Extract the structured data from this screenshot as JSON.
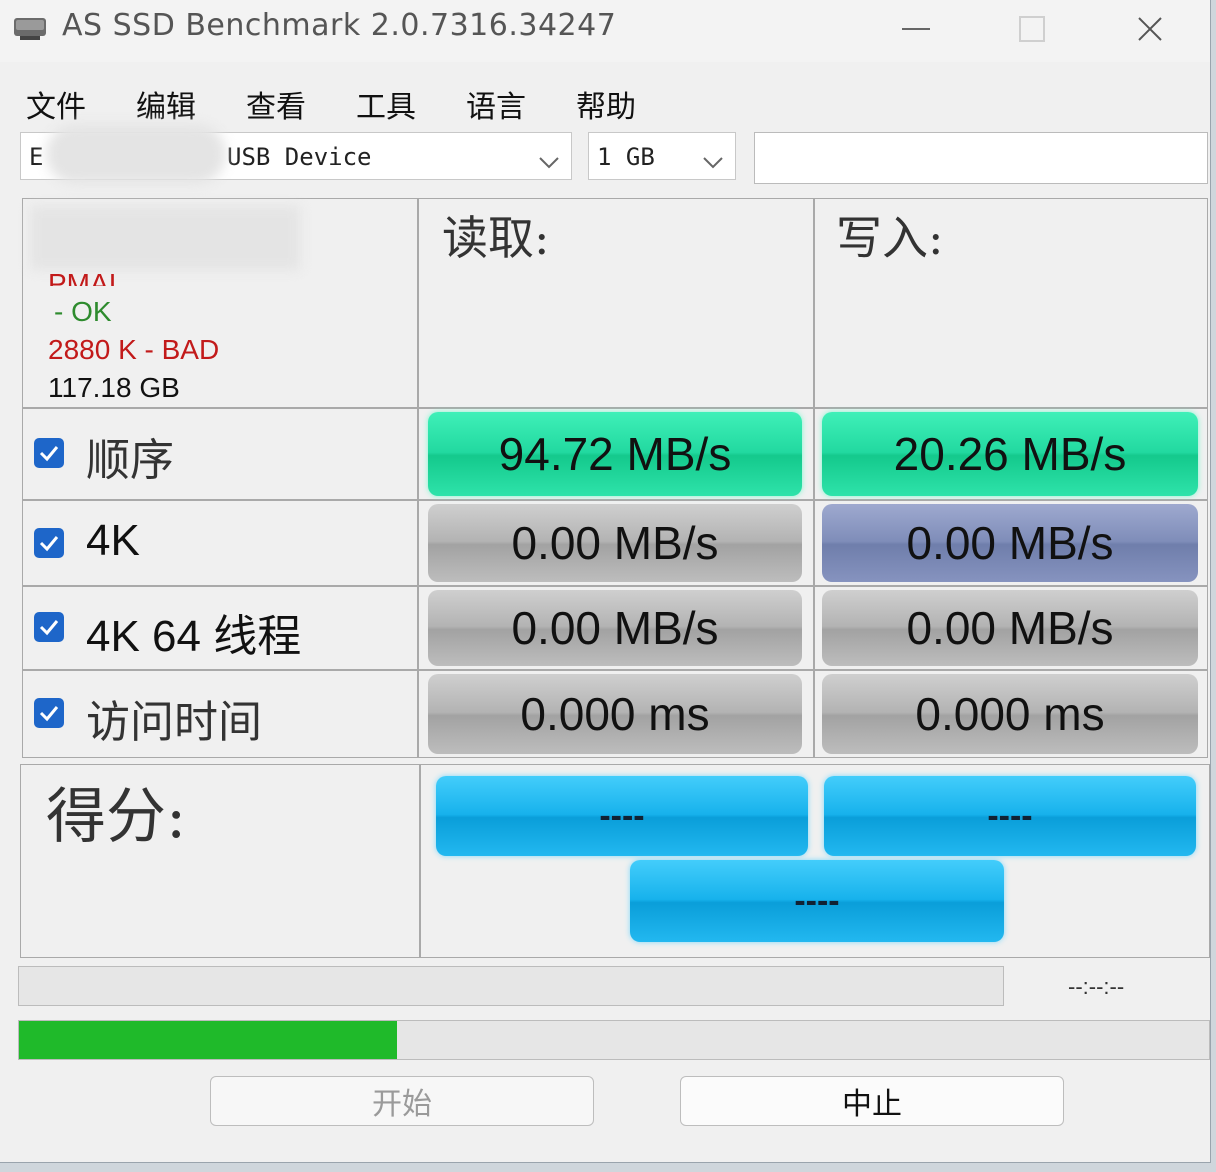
{
  "window": {
    "title": "AS SSD Benchmark 2.0.7316.34247"
  },
  "menu": [
    "文件",
    "编辑",
    "查看",
    "工具",
    "语言",
    "帮助"
  ],
  "toolbar": {
    "drive_prefix": "E",
    "drive_suffix": "USB Device",
    "size_value": "1 GB",
    "extra_field_value": ""
  },
  "drive_info": {
    "line_partial": "PMAI",
    "status_ok": "- OK",
    "status_bad": "2880 K - BAD",
    "capacity": "117.18 GB",
    "ok_color": "#2e8b2e",
    "bad_color": "#c21a1a"
  },
  "headers": {
    "read": "读取:",
    "write": "写入:"
  },
  "tests": [
    {
      "label": "顺序",
      "checked": true,
      "read": "94.72 MB/s",
      "write": "20.26 MB/s"
    },
    {
      "label": "4K",
      "checked": true,
      "read": "0.00 MB/s",
      "write": "0.00 MB/s"
    },
    {
      "label": "4K 64 线程",
      "checked": true,
      "read": "0.00 MB/s",
      "write": "0.00 MB/s"
    },
    {
      "label": "访问时间",
      "checked": true,
      "read": "0.000 ms",
      "write": "0.000 ms"
    }
  ],
  "score": {
    "label": "得分:",
    "read": "----",
    "write": "----",
    "total": "----"
  },
  "progress": {
    "time_text": "--:--:--",
    "bar1_fraction": 0.0,
    "bar2_fraction": 0.318
  },
  "buttons": {
    "start": "开始",
    "stop": "中止"
  },
  "colors": {
    "result_green": "#22d9a0",
    "result_gray": "#b3b3b3",
    "result_slate": "#7f8db9",
    "score_blue": "#17b2ec",
    "progress_green": "#1fba2a",
    "checkbox_blue": "#1e66c9"
  }
}
